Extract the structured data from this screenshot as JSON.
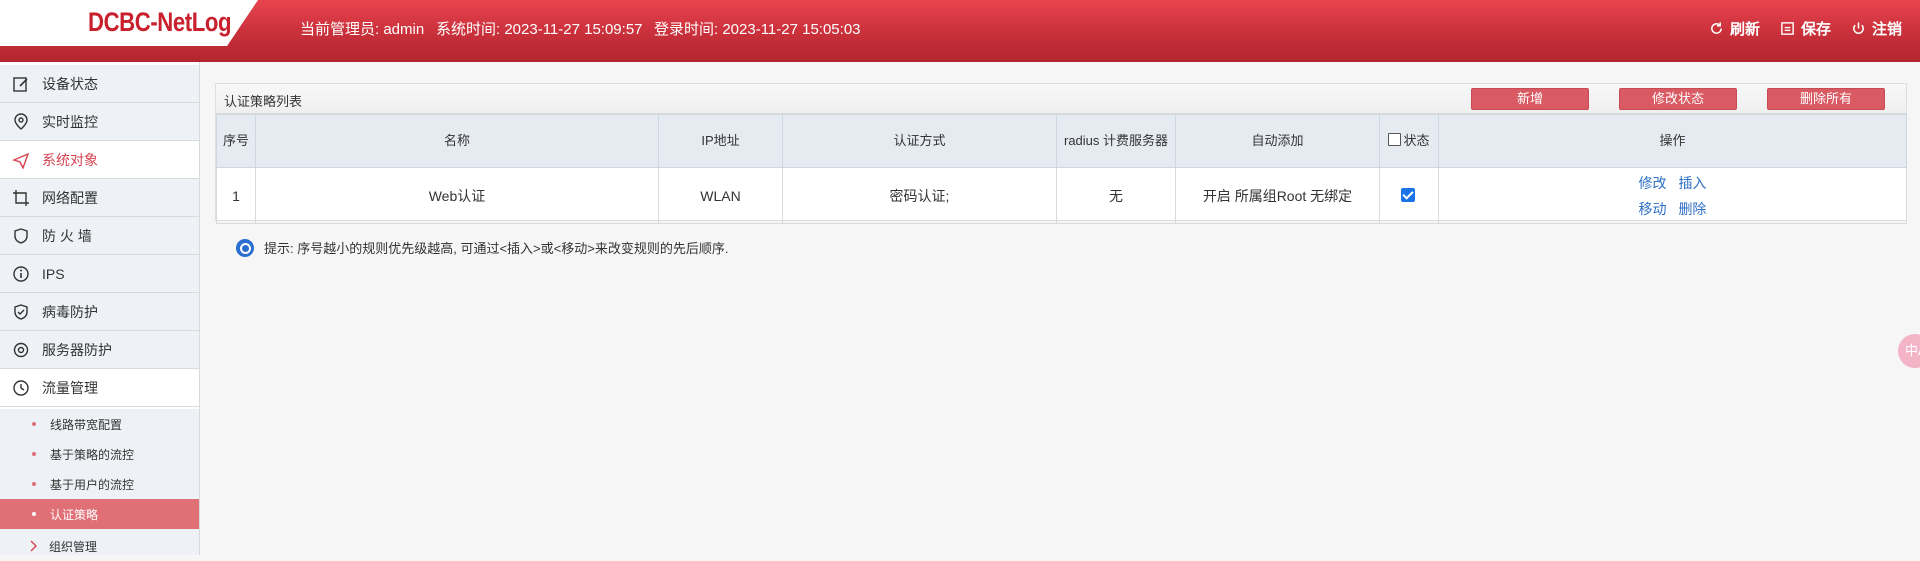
{
  "header": {
    "logo": "DCBC-NetLog",
    "admin_label": "当前管理员: admin",
    "system_time": "系统时间: 2023-11-27 15:09:57",
    "login_time": "登录时间: 2023-11-27 15:05:03",
    "buttons": {
      "refresh": "刷新",
      "save": "保存",
      "logout": "注销"
    }
  },
  "sidebar": {
    "items": [
      {
        "label": "设备状态"
      },
      {
        "label": "实时监控"
      },
      {
        "label": "系统对象"
      },
      {
        "label": "网络配置"
      },
      {
        "label": "防 火 墙"
      },
      {
        "label": "IPS"
      },
      {
        "label": "病毒防护"
      },
      {
        "label": "服务器防护"
      },
      {
        "label": "流量管理"
      }
    ],
    "sub_items": [
      {
        "label": "线路带宽配置"
      },
      {
        "label": "基于策略的流控"
      },
      {
        "label": "基于用户的流控"
      },
      {
        "label": "认证策略"
      },
      {
        "label": "组织管理"
      }
    ]
  },
  "panel": {
    "title": "认证策略列表",
    "buttons": {
      "add": "新增",
      "modify_status": "修改状态",
      "delete_all": "删除所有"
    },
    "columns": {
      "seq": "序号",
      "name": "名称",
      "ip": "IP地址",
      "auth": "认证方式",
      "radius": "radius 计费服务器",
      "auto_add": "自动添加",
      "status": "状态",
      "ops": "操作"
    },
    "rows": [
      {
        "seq": "1",
        "name": "Web认证",
        "ip": "WLAN",
        "auth": "密码认证;",
        "radius": "无",
        "auto_add": "开启 所属组Root 无绑定",
        "status_checked": true,
        "ops": {
          "edit": "修改",
          "insert": "插入",
          "move": "移动",
          "delete": "删除"
        }
      }
    ]
  },
  "tip": "提示: 序号越小的规则优先级越高, 可通过<插入>或<移动>来改变规则的先后顺序.",
  "float_badge": "中A"
}
